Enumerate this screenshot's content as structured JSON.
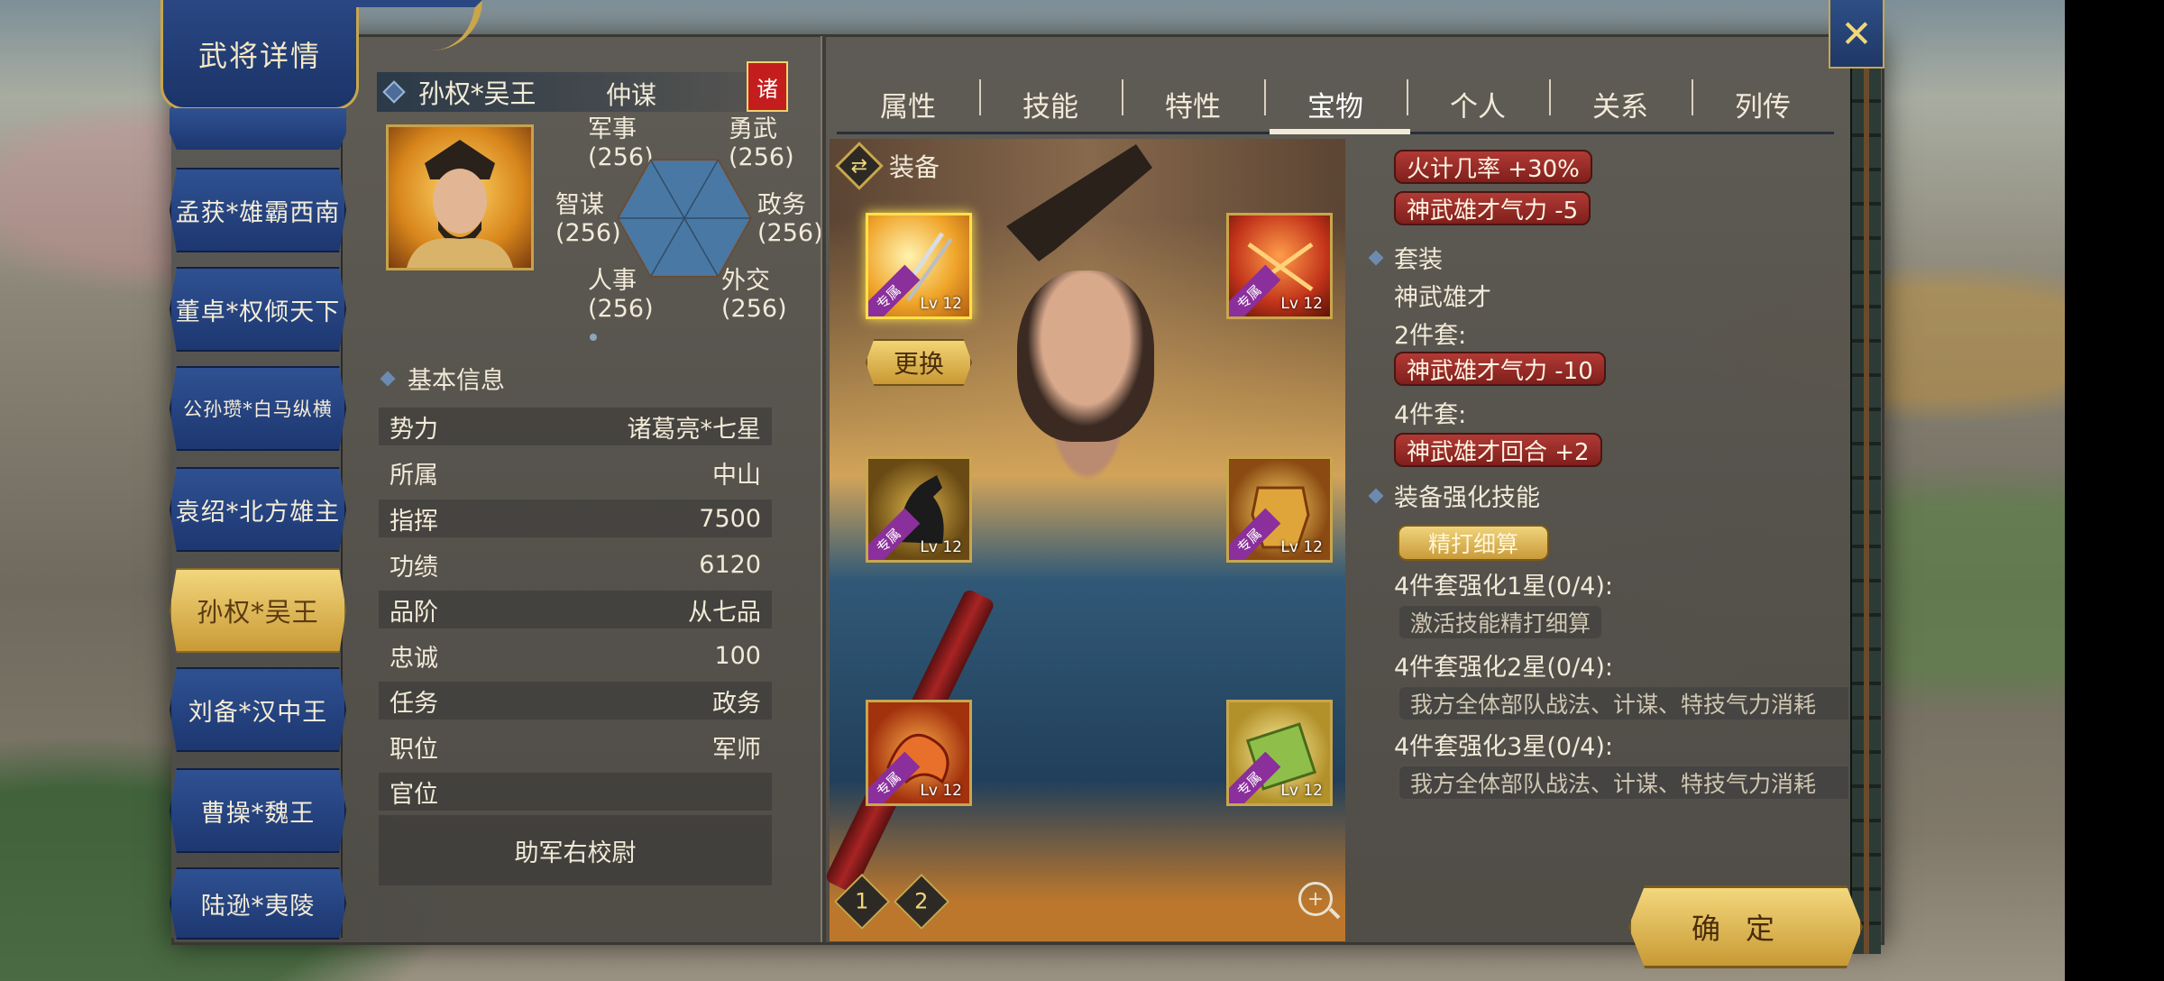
{
  "window": {
    "title": "武将详情"
  },
  "close_icon": "close-x-icon",
  "generals_list": [
    {
      "label": "孟获*雄霸西南",
      "active": false
    },
    {
      "label": "董卓*权倾天下",
      "active": false
    },
    {
      "label": "公孙瓒*白马纵横",
      "active": false
    },
    {
      "label": "袁绍*北方雄主",
      "active": false
    },
    {
      "label": "孙权*吴王",
      "active": true
    },
    {
      "label": "刘备*汉中王",
      "active": false
    },
    {
      "label": "曹操*魏王",
      "active": false
    },
    {
      "label": "陆逊*夷陵",
      "active": false
    }
  ],
  "general": {
    "name": "孙权*吴王",
    "title": "仲谋",
    "faction_badge": "诸",
    "stats": {
      "military": {
        "label": "军事",
        "value": "(256)"
      },
      "valor": {
        "label": "勇武",
        "value": "(256)"
      },
      "strategy": {
        "label": "智谋",
        "value": "(256)"
      },
      "politics": {
        "label": "政务",
        "value": "(256)"
      },
      "personnel": {
        "label": "人事",
        "value": "(256)"
      },
      "diplomacy": {
        "label": "外交",
        "value": "(256)"
      }
    }
  },
  "basic_info": {
    "header": "基本信息",
    "rows": [
      {
        "label": "势力",
        "value": "诸葛亮*七星"
      },
      {
        "label": "所属",
        "value": "中山"
      },
      {
        "label": "指挥",
        "value": "7500"
      },
      {
        "label": "功绩",
        "value": "6120"
      },
      {
        "label": "品阶",
        "value": "从七品"
      },
      {
        "label": "忠诚",
        "value": "100"
      },
      {
        "label": "任务",
        "value": "政务"
      },
      {
        "label": "职位",
        "value": "军师"
      },
      {
        "label": "官位",
        "value": ""
      }
    ],
    "official_title": "助军右校尉"
  },
  "tabs": [
    {
      "label": "属性",
      "active": false
    },
    {
      "label": "技能",
      "active": false
    },
    {
      "label": "特性",
      "active": false
    },
    {
      "label": "宝物",
      "active": true
    },
    {
      "label": "个人",
      "active": false
    },
    {
      "label": "关系",
      "active": false
    },
    {
      "label": "列传",
      "active": false
    }
  ],
  "equipment": {
    "header": "装备",
    "replace_label": "更换",
    "exclusive_label": "专属",
    "slots": [
      {
        "icon": "twin-swords-icon",
        "level": "Lv 12",
        "selected": true
      },
      {
        "icon": "twin-blades-icon",
        "level": "Lv 12",
        "selected": false
      },
      {
        "icon": "black-horse-icon",
        "level": "Lv 12",
        "selected": false
      },
      {
        "icon": "golden-armor-icon",
        "level": "Lv 12",
        "selected": false
      },
      {
        "icon": "fire-dragon-icon",
        "level": "Lv 12",
        "selected": false
      },
      {
        "icon": "scroll-icon",
        "level": "Lv 12",
        "selected": false
      }
    ],
    "pages": [
      "1",
      "2"
    ]
  },
  "details": {
    "effects": [
      "火计几率 +30%",
      "神武雄才气力 -5"
    ],
    "set_header": "套装",
    "set_name": "神武雄才",
    "set2_label": "2件套:",
    "set2_effect": "神武雄才气力 -10",
    "set4_label": "4件套:",
    "set4_effect": "神武雄才回合 +2",
    "enhance_header": "装备强化技能",
    "enhance_skill": "精打细算",
    "enh1_label": "4件套强化1星(0/4):",
    "enh1_effect": "激活技能精打细算",
    "enh2_label": "4件套强化2星(0/4):",
    "enh2_effect": "我方全体部队战法、计谋、特技气力消耗",
    "enh3_label": "4件套强化3星(0/4):",
    "enh3_effect": "我方全体部队战法、计谋、特技气力消耗"
  },
  "confirm_label": "确定",
  "colors": {
    "banner_blue": "#2a4784",
    "gold": "#c9a64c",
    "effect_red": "#b13a35",
    "exclusive_purple": "#8a2f9b"
  }
}
